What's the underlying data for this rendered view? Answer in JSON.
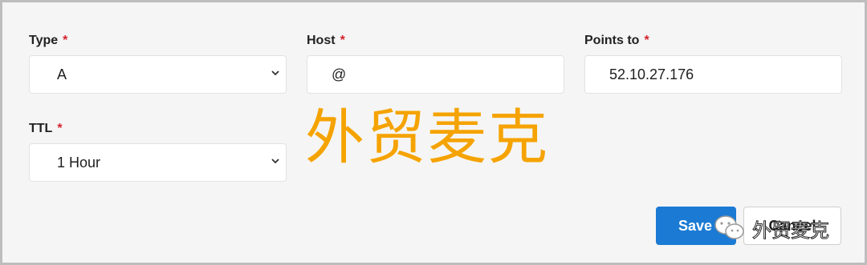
{
  "form": {
    "type": {
      "label": "Type",
      "required_mark": "*",
      "value": "A"
    },
    "host": {
      "label": "Host",
      "required_mark": "*",
      "value": "@"
    },
    "points_to": {
      "label": "Points to",
      "required_mark": "*",
      "value": "52.10.27.176"
    },
    "ttl": {
      "label": "TTL",
      "required_mark": "*",
      "value": "1 Hour"
    }
  },
  "actions": {
    "save_label": "Save",
    "cancel_label": "Cancel"
  },
  "watermark": {
    "text": "外贸麦克",
    "overlay_text": "外贸麦克"
  },
  "colors": {
    "accent": "#1b7bd4",
    "required": "#d5232f",
    "watermark": "#f5a300"
  }
}
